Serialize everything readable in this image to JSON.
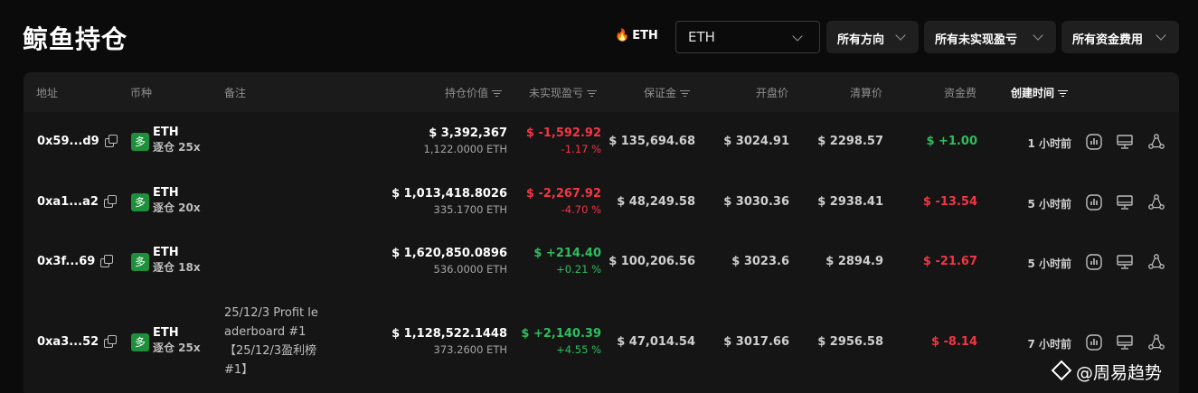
{
  "page": {
    "title": "鲸鱼持仓"
  },
  "filters": {
    "coin_tag": "ETH",
    "coin_select": "ETH",
    "direction": "所有方向",
    "pnl": "所有未实现盈亏",
    "funding": "所有资金费用"
  },
  "columns": {
    "address": "地址",
    "coin": "币种",
    "note": "备注",
    "position_value": "持仓价值",
    "unrealized_pnl": "未实现盈亏",
    "margin": "保证金",
    "open_price": "开盘价",
    "liq_price": "清算价",
    "funding_fee": "资金费",
    "created_time": "创建时间"
  },
  "rows": [
    {
      "address": "0x59...d9",
      "side": "多",
      "coin": "ETH",
      "leverage": "逐仓 25x",
      "note": "",
      "value": "$ 3,392,367",
      "size": "1,122.0000 ETH",
      "pnl": "$ -1,592.92",
      "pnl_pct": "-1.17 %",
      "pnl_sign": "neg",
      "margin": "$ 135,694.68",
      "open": "$ 3024.91",
      "liq": "$ 2298.57",
      "funding": "$ +1.00",
      "funding_sign": "pos",
      "time": "1 小时前"
    },
    {
      "address": "0xa1...a2",
      "side": "多",
      "coin": "ETH",
      "leverage": "逐仓 20x",
      "note": "",
      "value": "$ 1,013,418.8026",
      "size": "335.1700 ETH",
      "pnl": "$ -2,267.92",
      "pnl_pct": "-4.70 %",
      "pnl_sign": "neg",
      "margin": "$ 48,249.58",
      "open": "$ 3030.36",
      "liq": "$ 2938.41",
      "funding": "$ -13.54",
      "funding_sign": "neg",
      "time": "5 小时前"
    },
    {
      "address": "0x3f...69",
      "side": "多",
      "coin": "ETH",
      "leverage": "逐仓 18x",
      "note": "",
      "value": "$ 1,620,850.0896",
      "size": "536.0000 ETH",
      "pnl": "$ +214.40",
      "pnl_pct": "+0.21 %",
      "pnl_sign": "pos",
      "margin": "$ 100,206.56",
      "open": "$ 3023.6",
      "liq": "$ 2894.9",
      "funding": "$ -21.67",
      "funding_sign": "neg",
      "time": "5 小时前"
    },
    {
      "address": "0xa3...52",
      "side": "多",
      "coin": "ETH",
      "leverage": "逐仓 25x",
      "note": "25/12/3 Profit leaderboard #1【25/12/3盈利榜#1】",
      "value": "$ 1,128,522.1448",
      "size": "373.2600 ETH",
      "pnl": "$ +2,140.39",
      "pnl_pct": "+4.55 %",
      "pnl_sign": "pos",
      "margin": "$ 47,014.54",
      "open": "$ 3017.66",
      "liq": "$ 2956.58",
      "funding": "$ -8.14",
      "funding_sign": "neg",
      "time": "7 小时前"
    }
  ],
  "watermark": "@周易趋势",
  "icons": [
    "copy-icon",
    "chart-icon",
    "monitor-icon",
    "share-icon",
    "sort-icon",
    "chevron-down-icon",
    "fire-icon"
  ],
  "colors": {
    "positive": "#2ebd5f",
    "negative": "#f23645",
    "badge": "#1e8f3c"
  }
}
